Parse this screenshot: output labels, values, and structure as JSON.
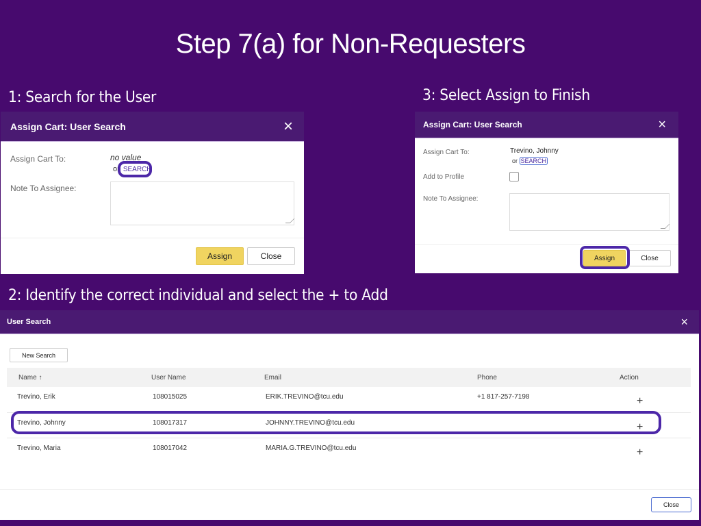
{
  "slide": {
    "title": "Step 7(a) for Non-Requesters",
    "step1": "1:  Search for the User",
    "step2": "2:  Identify the correct individual and select the + to Add",
    "step3": "3:  Select Assign to Finish"
  },
  "dialog1": {
    "title": "Assign Cart: User Search",
    "close_icon": "×",
    "assign_to_label": "Assign Cart To:",
    "assign_to_value": "no value",
    "or_text": "or",
    "search_link": "SEARCH",
    "note_label": "Note To Assignee:",
    "note_value": "",
    "assign_button": "Assign",
    "close_button": "Close"
  },
  "dialog3": {
    "title": "Assign Cart: User Search",
    "close_icon": "×",
    "assign_to_label": "Assign Cart To:",
    "assign_to_value": "Trevino, Johnny",
    "or_text": "or",
    "search_link": "SEARCH",
    "add_profile_label": "Add to Profile",
    "add_profile_checked": false,
    "note_label": "Note To Assignee:",
    "note_value": "",
    "assign_button": "Assign",
    "close_button": "Close"
  },
  "user_search": {
    "title": "User Search",
    "close_icon": "×",
    "new_search_button": "New Search",
    "columns": [
      "Name ↑",
      "User Name",
      "Email",
      "Phone",
      "Action"
    ],
    "rows": [
      {
        "name": "Trevino, Erik",
        "username": "108015025",
        "email": "ERIK.TREVINO@tcu.edu",
        "phone": "+1 817-257-7198",
        "action": "+"
      },
      {
        "name": "Trevino, Johnny",
        "username": "108017317",
        "email": "JOHNNY.TREVINO@tcu.edu",
        "phone": "",
        "action": "+"
      },
      {
        "name": "Trevino, Maria",
        "username": "108017042",
        "email": "MARIA.G.TREVINO@tcu.edu",
        "phone": "",
        "action": "+"
      }
    ],
    "close_button": "Close"
  },
  "colors": {
    "background": "#470a6e",
    "header": "#4a1a72",
    "highlight": "#4c27a8",
    "assign_button": "#f0d460"
  }
}
